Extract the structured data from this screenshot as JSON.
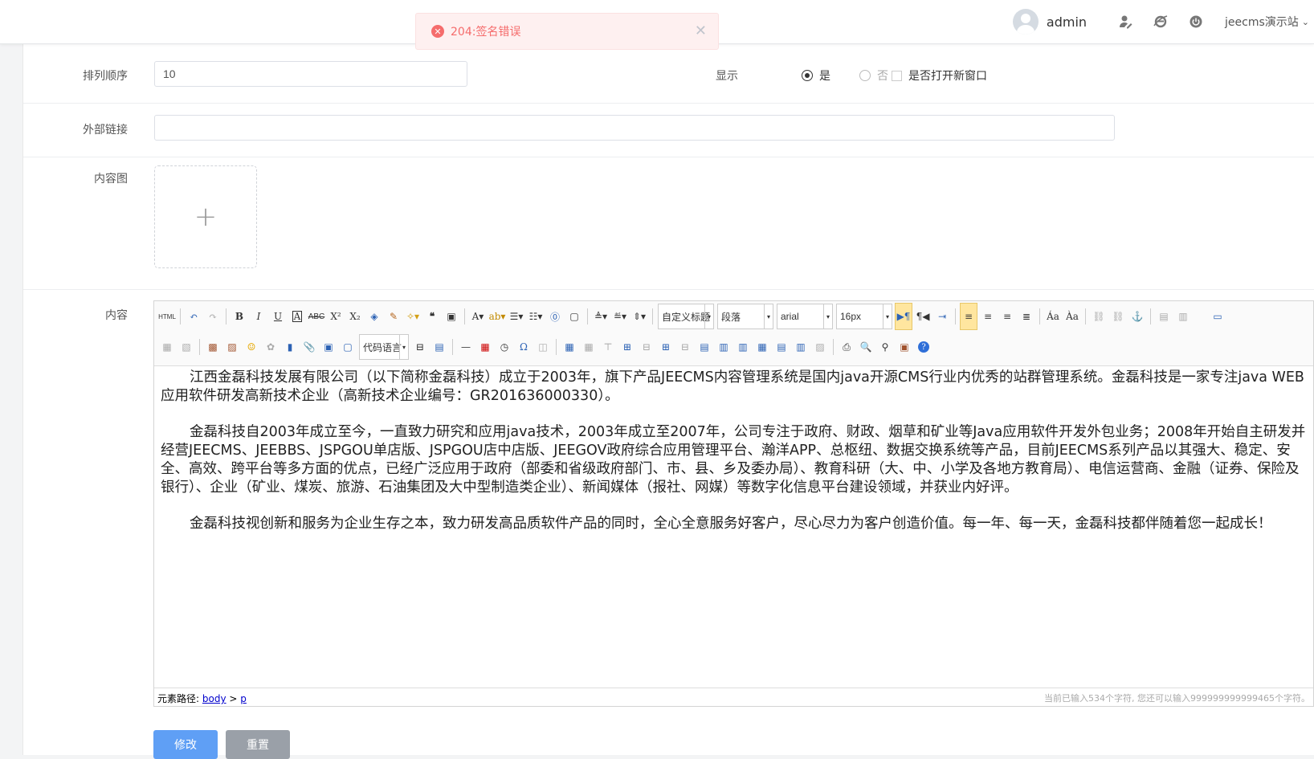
{
  "header": {
    "username": "admin",
    "site_selector": "jeecms演示站",
    "icons": [
      "user-settings-icon",
      "browser-icon",
      "power-icon"
    ]
  },
  "alert": {
    "message": "204:签名错误",
    "type": "error",
    "color": "#f56c6c"
  },
  "form": {
    "sort_order": {
      "label": "排列顺序",
      "value": "10"
    },
    "display": {
      "label": "显示",
      "options": [
        "是",
        "否"
      ],
      "selected": "是",
      "new_window_label": "是否打开新窗口",
      "new_window_checked": false
    },
    "external_link": {
      "label": "外部链接",
      "value": ""
    },
    "content_image": {
      "label": "内容图",
      "add_symbol": "+"
    },
    "content": {
      "label": "内容",
      "toolbar": {
        "custom_title": "自定义标题",
        "paragraph": "段落",
        "font_family": "arial",
        "font_size": "16px",
        "code_language": "代码语言"
      },
      "paragraphs": [
        "江西金磊科技发展有限公司（以下简称金磊科技）成立于2003年，旗下产品JEECMS内容管理系统是国内java开源CMS行业内优秀的站群管理系统。金磊科技是一家专注java WEB应用软件研发高新技术企业（高新技术企业编号：GR201636000330）。",
        "金磊科技自2003年成立至今，一直致力研究和应用java技术，2003年成立至2007年，公司专注于政府、财政、烟草和矿业等Java应用软件开发外包业务；2008年开始自主研发并经营JEECMS、JEEBBS、JSPGOU单店版、JSPGOU店中店版、JEEGOV政府综合应用管理平台、瀚洋APP、总枢纽、数据交换系统等产品，目前JEECMS系列产品以其强大、稳定、安全、高效、跨平台等多方面的优点，已经广泛应用于政府（部委和省级政府部门、市、县、乡及委办局）、教育科研（大、中、小学及各地方教育局）、电信运营商、金融（证券、保险及银行）、企业（矿业、煤炭、旅游、石油集团及大中型制造类企业）、新闻媒体（报社、网媒）等数字化信息平台建设领域，并获业内好评。",
        "金磊科技视创新和服务为企业生存之本，致力研发高品质软件产品的同时，全心全意服务好客户，尽心尽力为客户创造价值。每一年、每一天，金磊科技都伴随着您一起成长！"
      ],
      "status": {
        "path_label": "元素路径:",
        "path_body": "body",
        "path_sep": ">",
        "path_p": "p",
        "char_count": "当前已输入534个字符, 您还可以输入999999999999465个字符。"
      }
    },
    "buttons": {
      "submit": "修改",
      "reset": "重置"
    }
  }
}
